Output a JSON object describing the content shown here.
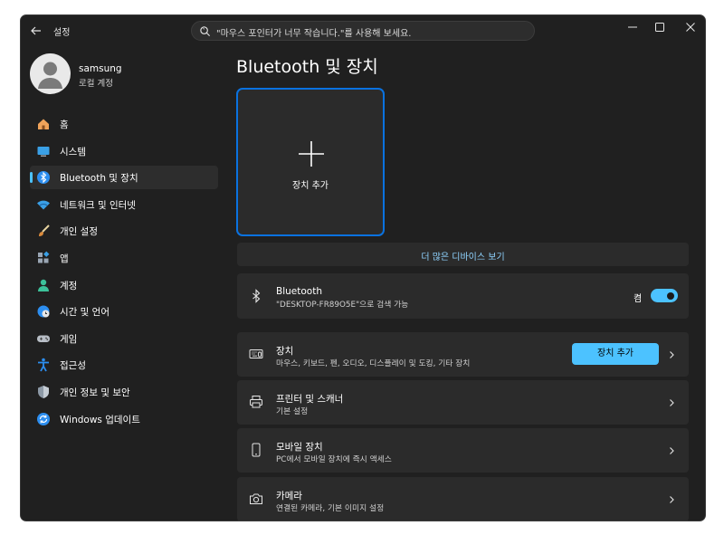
{
  "titlebar": {
    "title": "설정",
    "search_text": "\"마우스 포인터가 너무 작습니다.\"를 사용해 보세요."
  },
  "profile": {
    "name": "samsung",
    "account_type": "로컬 계정"
  },
  "sidebar": {
    "items": [
      {
        "label": "홈",
        "icon": "home-icon"
      },
      {
        "label": "시스템",
        "icon": "monitor-icon"
      },
      {
        "label": "Bluetooth 및 장치",
        "icon": "bluetooth-icon",
        "selected": true
      },
      {
        "label": "네트워크 및 인터넷",
        "icon": "wifi-icon"
      },
      {
        "label": "개인 설정",
        "icon": "brush-icon"
      },
      {
        "label": "앱",
        "icon": "apps-icon"
      },
      {
        "label": "계정",
        "icon": "person-icon"
      },
      {
        "label": "시간 및 언어",
        "icon": "globe-clock-icon"
      },
      {
        "label": "게임",
        "icon": "gamepad-icon"
      },
      {
        "label": "접근성",
        "icon": "accessibility-icon"
      },
      {
        "label": "개인 정보 및 보안",
        "icon": "shield-icon"
      },
      {
        "label": "Windows 업데이트",
        "icon": "update-icon"
      }
    ]
  },
  "main": {
    "title": "Bluetooth 및 장치",
    "add_tile_label": "장치 추가",
    "more_devices_label": "더 많은 디바이스 보기",
    "bluetooth": {
      "title": "Bluetooth",
      "subtitle": "\"DESKTOP-FR89O5E\"으로 검색 가능",
      "toggle_label": "켬",
      "toggle_on": true
    },
    "cards": [
      {
        "title": "장치",
        "subtitle": "마우스, 키보드, 펜, 오디오, 디스플레이 및 도킹, 기타 장치",
        "icon": "devices-icon",
        "button": "장치 추가"
      },
      {
        "title": "프린터 및 스캐너",
        "subtitle": "기본 설정",
        "icon": "printer-icon"
      },
      {
        "title": "모바일 장치",
        "subtitle": "PC에서 모바일 장치에 즉시 액세스",
        "icon": "phone-icon"
      },
      {
        "title": "카메라",
        "subtitle": "연결된 카메라, 기본 이미지 설정",
        "icon": "camera-icon"
      }
    ]
  },
  "colors": {
    "accent": "#4cc2ff",
    "tile_border": "#0a72e0",
    "background": "#202020",
    "card": "#2b2b2b"
  }
}
